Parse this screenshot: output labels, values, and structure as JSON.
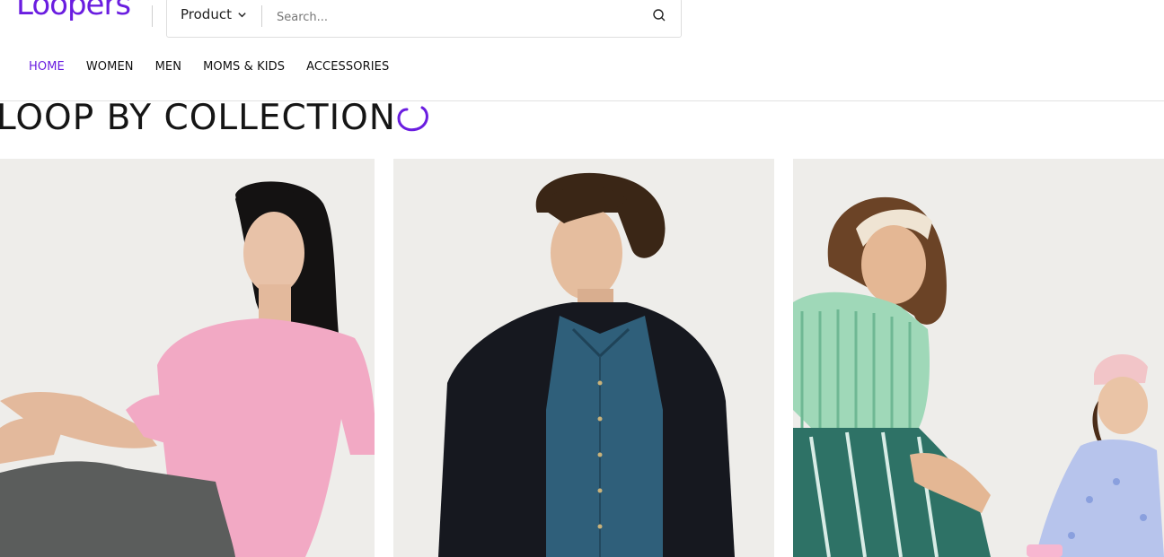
{
  "brand": {
    "logo_text": "Loopers",
    "accent_color": "#6a1de0"
  },
  "search": {
    "category_label": "Product",
    "placeholder": "Search...",
    "icon": "search-icon"
  },
  "nav": {
    "items": [
      {
        "label": "HOME",
        "active": true
      },
      {
        "label": "WOMEN",
        "active": false
      },
      {
        "label": "MEN",
        "active": false
      },
      {
        "label": "MOMS & KIDS",
        "active": false
      },
      {
        "label": "ACCESSORIES",
        "active": false
      }
    ]
  },
  "section": {
    "title": "LOOP BY COLLECTION",
    "icon": "loop-swirl-icon"
  },
  "collections": [
    {
      "name": "women-collection-image",
      "icon": "photo-woman-pink-sweater"
    },
    {
      "name": "men-collection-image",
      "icon": "photo-man-denim-jacket"
    },
    {
      "name": "moms-kids-collection-image",
      "icon": "photo-mom-and-child"
    }
  ]
}
